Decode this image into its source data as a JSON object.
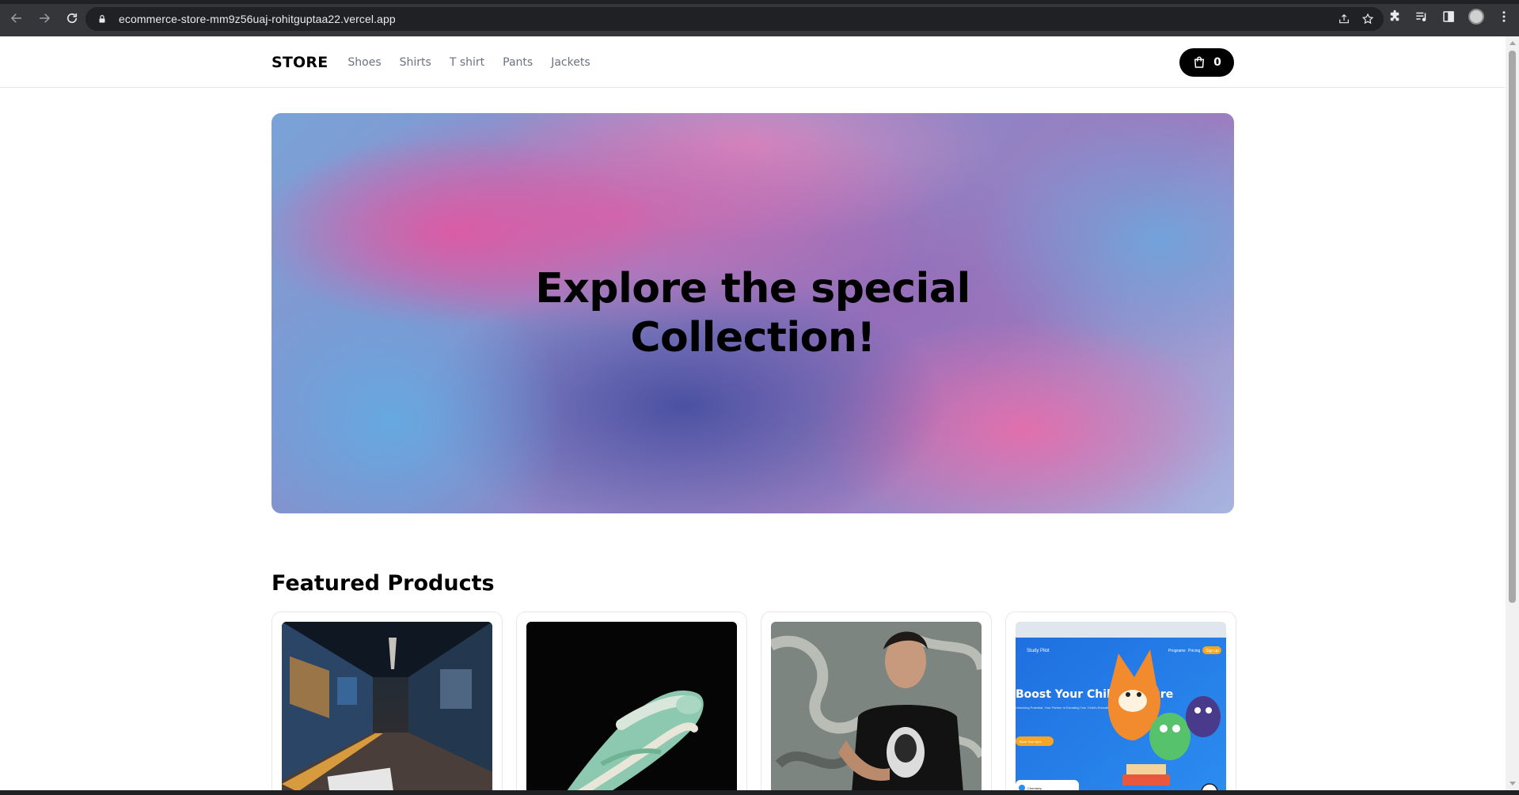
{
  "browser": {
    "url": "ecommerce-store-mm9z56uaj-rohitguptaa22.vercel.app"
  },
  "store": {
    "logo": "STORE",
    "nav": [
      "Shoes",
      "Shirts",
      "T shirt",
      "Pants",
      "Jackets"
    ],
    "cart_count": "0"
  },
  "hero": {
    "title": "Explore the special Collection!"
  },
  "featured": {
    "title": "Featured Products",
    "products": [
      {
        "image": "subway-station-photo"
      },
      {
        "image": "mint-sneaker-photo"
      },
      {
        "image": "man-black-tshirt-photo"
      },
      {
        "image": "study-pilot-website-screenshot",
        "image_text": [
          "Study Pilot",
          "Programs",
          "Pricing",
          "Sign up",
          "Boost Your Child's Future",
          "Unlocking Potential, Your Partner in Elevating Your Child's Educational Journey",
          "Book Your Spot",
          "Chemistry"
        ]
      }
    ]
  },
  "colors": {
    "header_bg": "#ffffff",
    "cart_bg": "#000000",
    "nav_text": "#6b7280"
  }
}
